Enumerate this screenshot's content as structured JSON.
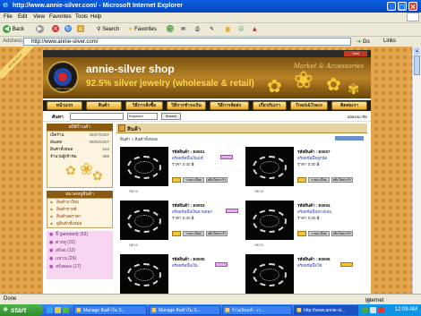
{
  "window": {
    "title": "http://www.annie-silver.com/ - Microsoft Internet Explorer"
  },
  "menu": [
    "File",
    "Edit",
    "View",
    "Favorites",
    "Tools",
    "Help"
  ],
  "toolbar": {
    "back": "Back",
    "search": "Search",
    "favorites": "Favorites"
  },
  "address": {
    "label": "Address",
    "url": "http://www.annie-silver.com/",
    "go": "Go",
    "links": "Links"
  },
  "site": {
    "ribbon": "annie-silver",
    "top_badge": "Visit",
    "name": "annie-silver shop",
    "tagline": "92.5% silver jewelry (wholesale & retail)",
    "script_text": "Market & Accessories",
    "logo_text": "ANNIE SILVER",
    "nav": [
      "หน้าแรก",
      "สินค้า",
      "วิธีการสั่งซื้อ",
      "วิธีการชำระเงิน",
      "วิธีการจัดส่ง",
      "เกี่ยวกับเรา",
      "Track&Trace",
      "ติดต่อเรา"
    ],
    "search": {
      "label": "ค้นหา",
      "keyword": "Keyword",
      "button": "Search",
      "right": "สมัครสมาชิก"
    }
  },
  "sidebar": {
    "stats_title": "สถิติร้านค้า",
    "stats": [
      {
        "label": "เปิดร้าน",
        "value": "25/07/2007"
      },
      {
        "label": "อัพเดท",
        "value": "09/04/2007"
      },
      {
        "label": "สินค้าทั้งหมด",
        "value": "510"
      },
      {
        "label": "จำนวนผู้เข้าชม",
        "value": "358"
      }
    ],
    "category_title": "หมวดหมู่สินค้า",
    "categories": [
      "สินค้ามาใหม่",
      "สินค้าขายดี",
      "สินค้าลดราคา",
      "ดูสินค้าทั้งหมด"
    ],
    "groups": [
      "จี้ (pendant) (53)",
      "ต่างหู (31)",
      "สร้อย (12)",
      "แหวน (26)",
      "สร้อยคอ (17)"
    ]
  },
  "main": {
    "heading": "สินค้า",
    "breadcrumb": "สินค้า > สินค้าทั้งหมด",
    "products": [
      {
        "code": "รหัสสินค้า : E0001",
        "name": "สร้อยข้อมือเงินแท้",
        "price": "ราคา 0.00 ฿"
      },
      {
        "code": "รหัสสินค้า : E0007",
        "name": "สร้อยข้อมือลูกปัด",
        "price": "ราคา 0.00 ฿"
      },
      {
        "code": "รหัสสินค้า : E0003",
        "name": "สร้อยข้อมือเงินลายดอก",
        "price": "ราคา 0.00 ฿"
      },
      {
        "code": "รหัสสินค้า : E0004",
        "name": "สร้อยข้อมือห่วงกลม",
        "price": "ราคา 0.00 ฿"
      },
      {
        "code": "รหัสสินค้า : E0005",
        "name": "สร้อยข้อมือเงิน",
        "price": ""
      },
      {
        "code": "รหัสสินค้า : E0006",
        "name": "สร้อยข้อมือโซ่",
        "price": ""
      }
    ],
    "view_label": "รายละเอียด",
    "buy_label": "หยิบใส่ตะกร้า",
    "zoom_label": "ขยาย"
  },
  "status": {
    "left": "Done",
    "right": "Internet"
  },
  "taskbar": {
    "start": "start",
    "tasks": [
      "Manage สินค้าใน S...",
      "Manage สินค้าใน S...",
      "ร้านเงินแท้ - เว...",
      "http://www.annie-si..."
    ],
    "clock": "12:09 AM"
  }
}
